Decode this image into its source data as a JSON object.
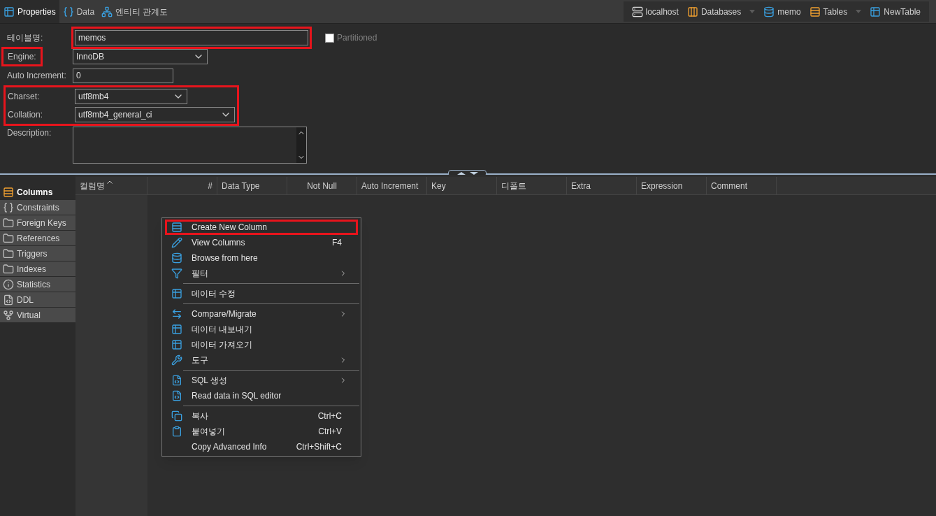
{
  "tabs": [
    {
      "label": "Properties",
      "selected": true
    },
    {
      "label": "Data",
      "selected": false
    },
    {
      "label": "엔티티 관계도",
      "selected": false
    }
  ],
  "breadcrumb": [
    {
      "label": "localhost",
      "dropdown": false
    },
    {
      "label": "Databases",
      "dropdown": true
    },
    {
      "label": "memo",
      "dropdown": false
    },
    {
      "label": "Tables",
      "dropdown": true
    },
    {
      "label": "NewTable",
      "dropdown": false
    }
  ],
  "form": {
    "table_name": {
      "label": "테이블명:",
      "value": "memos",
      "highlighted": true
    },
    "partitioned": {
      "label": "Partitioned",
      "checked": false
    },
    "engine": {
      "label": "Engine:",
      "value": "InnoDB",
      "highlighted": true
    },
    "auto_increment": {
      "label": "Auto Increment:",
      "value": "0"
    },
    "charset_group_highlighted": true,
    "charset": {
      "label": "Charset:",
      "value": "utf8mb4"
    },
    "collation": {
      "label": "Collation:",
      "value": "utf8mb4_general_ci"
    },
    "description": {
      "label": "Description:"
    }
  },
  "sidebar": {
    "items": [
      {
        "label": "Columns",
        "selected": true
      },
      {
        "label": "Constraints",
        "selected": false
      },
      {
        "label": "Foreign Keys",
        "selected": false
      },
      {
        "label": "References",
        "selected": false
      },
      {
        "label": "Triggers",
        "selected": false
      },
      {
        "label": "Indexes",
        "selected": false
      },
      {
        "label": "Statistics",
        "selected": false
      },
      {
        "label": "DDL",
        "selected": false
      },
      {
        "label": "Virtual",
        "selected": false
      }
    ]
  },
  "table": {
    "columns": [
      {
        "label": "컬럼명",
        "sorted": true
      },
      {
        "label": "#",
        "sorted": false
      },
      {
        "label": "Data Type",
        "sorted": false
      },
      {
        "label": "Not Null",
        "sorted": false
      },
      {
        "label": "Auto Increment",
        "sorted": false
      },
      {
        "label": "Key",
        "sorted": false
      },
      {
        "label": "디폴트",
        "sorted": false
      },
      {
        "label": "Extra",
        "sorted": false
      },
      {
        "label": "Expression",
        "sorted": false
      },
      {
        "label": "Comment",
        "sorted": false
      }
    ]
  },
  "context_menu": [
    {
      "kind": "item",
      "label": "Create New Column",
      "highlighted": true,
      "submenu": false
    },
    {
      "kind": "item",
      "label": "View Columns",
      "shortcut": "F4",
      "highlighted": false,
      "submenu": false
    },
    {
      "kind": "item",
      "label": "Browse from here",
      "highlighted": false,
      "submenu": false
    },
    {
      "kind": "item",
      "label": "필터",
      "highlighted": false,
      "submenu": true
    },
    {
      "kind": "separator"
    },
    {
      "kind": "item",
      "label": "데이터 수정",
      "highlighted": false,
      "submenu": false
    },
    {
      "kind": "separator"
    },
    {
      "kind": "item",
      "label": "Compare/Migrate",
      "highlighted": false,
      "submenu": true
    },
    {
      "kind": "item",
      "label": "데이터 내보내기",
      "highlighted": false,
      "submenu": false
    },
    {
      "kind": "item",
      "label": "데이터 가져오기",
      "highlighted": false,
      "submenu": false
    },
    {
      "kind": "item",
      "label": "도구",
      "highlighted": false,
      "submenu": true
    },
    {
      "kind": "separator"
    },
    {
      "kind": "item",
      "label": "SQL 생성",
      "highlighted": false,
      "submenu": true
    },
    {
      "kind": "item",
      "label": "Read data in SQL editor",
      "highlighted": false,
      "submenu": false
    },
    {
      "kind": "separator"
    },
    {
      "kind": "item",
      "label": "복사",
      "shortcut": "Ctrl+C",
      "highlighted": false,
      "submenu": false
    },
    {
      "kind": "item",
      "label": "붙여넣기",
      "shortcut": "Ctrl+V",
      "highlighted": false,
      "submenu": false
    },
    {
      "kind": "item",
      "label": "Copy Advanced Info",
      "shortcut": "Ctrl+Shift+C",
      "highlighted": false,
      "submenu": false
    }
  ]
}
